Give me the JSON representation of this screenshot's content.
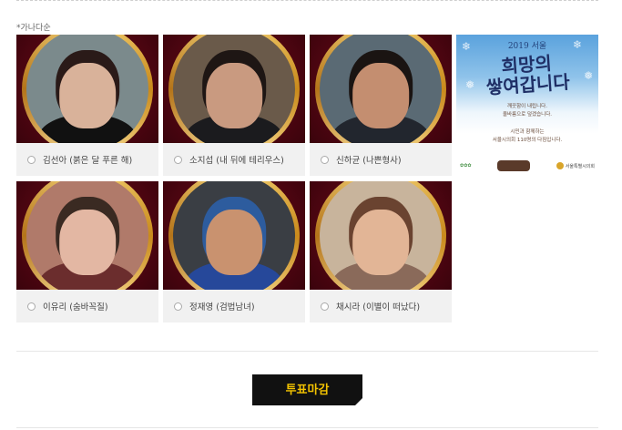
{
  "sort_note": "*가나다순",
  "candidates": [
    {
      "name": "김선아 (붉은 달 푸른 해)",
      "skin": "#d9b29a",
      "hair": "#2a1a18",
      "clothes": "#111111",
      "bg": "#7b8a8c"
    },
    {
      "name": "소지섭 (내 뒤에 테리우스)",
      "skin": "#c99a80",
      "hair": "#1e1614",
      "clothes": "#1b1b1e",
      "bg": "#6a5a4a"
    },
    {
      "name": "신하균 (나쁜형사)",
      "skin": "#c48e70",
      "hair": "#1a1412",
      "clothes": "#22262e",
      "bg": "#5a6a74"
    },
    {
      "name": "이유리 (숨바꼭질)",
      "skin": "#e3b7a3",
      "hair": "#3a2a22",
      "clothes": "#6b2d2d",
      "bg": "#b07a6a"
    },
    {
      "name": "정재영 (검법남녀)",
      "skin": "#c9926f",
      "hair": "#2d5c9e",
      "clothes": "#26489a",
      "bg": "#3a3e44"
    },
    {
      "name": "채시라 (이별이 떠났다)",
      "skin": "#e2b596",
      "hair": "#6a4330",
      "clothes": "#8a6a5a",
      "bg": "#c8b49c"
    }
  ],
  "ad": {
    "year": "2019 서울",
    "calligraphy_line1": "희망의",
    "calligraphy_line2": "쌓여갑니다",
    "copy_line1": "깨끗함이 내립니다.",
    "copy_line2": "올바름으로 덮겠습니다.",
    "copy_line3": "시민과 함께하는",
    "copy_line4": "서울시의회 110명의 다짐입니다.",
    "logo_org": "서울특별시의회"
  },
  "vote_button": "투표마감"
}
